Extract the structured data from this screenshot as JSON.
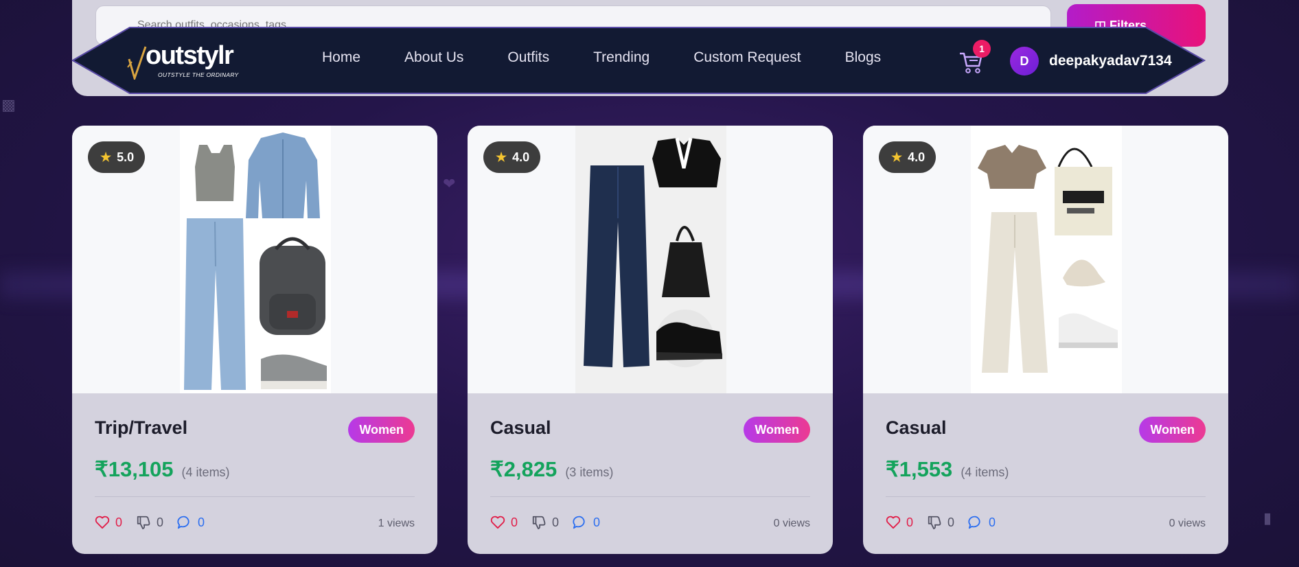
{
  "search": {
    "placeholder": "Search outfits, occasions, tags..."
  },
  "filter_button": {
    "label": "Filters",
    "icon": "filter-icon"
  },
  "brand": {
    "name": "outstylr",
    "tagline": "OUTSTYLE THE ORDINARY",
    "mark_color": "#d9a441"
  },
  "nav": {
    "links": [
      "Home",
      "About Us",
      "Outfits",
      "Trending",
      "Custom Request",
      "Blogs"
    ]
  },
  "cart": {
    "icon": "cart-icon",
    "count": "1"
  },
  "user": {
    "initial": "D",
    "username": "deepakyadav7134"
  },
  "colors": {
    "price": "#14a35c",
    "like": "#e11d48",
    "comment": "#2b6ef0",
    "badge_gradient_start": "#b63ae8",
    "badge_gradient_end": "#ec3a92"
  },
  "outfits": [
    {
      "rating": "5.0",
      "title": "Trip/Travel",
      "gender": "Women",
      "price": "₹13,105",
      "items": "(4 items)",
      "likes": "0",
      "dislikes": "0",
      "comments": "0",
      "views": "1 views",
      "pieces": [
        "gray crop tank top",
        "denim jacket",
        "wide-leg jeans",
        "gray backpack",
        "gray sneakers"
      ]
    },
    {
      "rating": "4.0",
      "title": "Casual",
      "gender": "Women",
      "price": "₹2,825",
      "items": "(3 items)",
      "likes": "0",
      "dislikes": "0",
      "comments": "0",
      "views": "0 views",
      "pieces": [
        "dark flared jeans",
        "black collared crop top",
        "black shoulder bag",
        "black chunky sneakers"
      ]
    },
    {
      "rating": "4.0",
      "title": "Casual",
      "gender": "Women",
      "price": "₹1,553",
      "items": "(4 items)",
      "likes": "0",
      "dislikes": "0",
      "comments": "0",
      "views": "0 views",
      "pieces": [
        "beige polo crop top",
        "tote bag",
        "cream wide pants",
        "beige cap",
        "white sneakers"
      ]
    }
  ]
}
